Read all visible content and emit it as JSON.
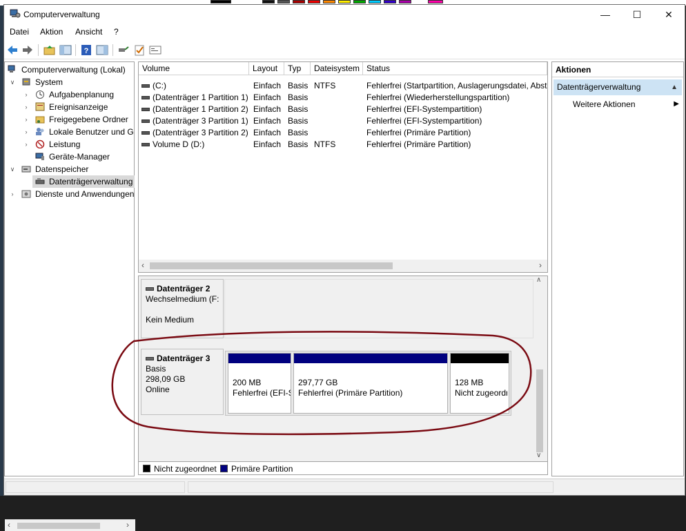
{
  "window": {
    "title": "Computerverwaltung"
  },
  "menu": {
    "items": [
      "Datei",
      "Aktion",
      "Ansicht",
      "?"
    ]
  },
  "tree": {
    "items": [
      {
        "label": "Computerverwaltung (Lokal)"
      },
      {
        "label": "System"
      },
      {
        "label": "Aufgabenplanung"
      },
      {
        "label": "Ereignisanzeige"
      },
      {
        "label": "Freigegebene Ordner"
      },
      {
        "label": "Lokale Benutzer und Gruppen"
      },
      {
        "label": "Leistung"
      },
      {
        "label": "Geräte-Manager"
      },
      {
        "label": "Datenspeicher"
      },
      {
        "label": "Datenträgerverwaltung"
      },
      {
        "label": "Dienste und Anwendungen"
      }
    ]
  },
  "volumes": {
    "columns": [
      "Volume",
      "Layout",
      "Typ",
      "Dateisystem",
      "Status"
    ],
    "rows": [
      {
        "volume": "(C:)",
        "layout": "Einfach",
        "typ": "Basis",
        "fs": "NTFS",
        "status": "Fehlerfrei (Startpartition, Auslagerungsdatei, Absturzabbild, Primäre Partition)"
      },
      {
        "volume": "(Datenträger 1 Partition 1)",
        "layout": "Einfach",
        "typ": "Basis",
        "fs": "",
        "status": "Fehlerfrei (Wiederherstellungspartition)"
      },
      {
        "volume": "(Datenträger 1 Partition 2)",
        "layout": "Einfach",
        "typ": "Basis",
        "fs": "",
        "status": "Fehlerfrei (EFI-Systempartition)"
      },
      {
        "volume": "(Datenträger 3 Partition 1)",
        "layout": "Einfach",
        "typ": "Basis",
        "fs": "",
        "status": "Fehlerfrei (EFI-Systempartition)"
      },
      {
        "volume": "(Datenträger 3 Partition 2)",
        "layout": "Einfach",
        "typ": "Basis",
        "fs": "",
        "status": "Fehlerfrei (Primäre Partition)"
      },
      {
        "volume": "Volume D (D:)",
        "layout": "Einfach",
        "typ": "Basis",
        "fs": "NTFS",
        "status": "Fehlerfrei (Primäre Partition)"
      }
    ]
  },
  "disks": {
    "disk2": {
      "name": "Datenträger 2",
      "type": "Wechselmedium (F:)",
      "status": "Kein Medium"
    },
    "disk3": {
      "name": "Datenträger 3",
      "type": "Basis",
      "size": "298,09 GB",
      "status": "Online",
      "partitions": [
        {
          "size": "200 MB",
          "status": "Fehlerfrei (EFI-Systempartition)",
          "color": "#00007f"
        },
        {
          "size": "297,77 GB",
          "status": "Fehlerfrei (Primäre Partition)",
          "color": "#00007f"
        },
        {
          "size": "128 MB",
          "status": "Nicht zugeordnet",
          "color": "#000000"
        }
      ]
    }
  },
  "legend": [
    {
      "label": "Nicht zugeordnet",
      "color": "#000000"
    },
    {
      "label": "Primäre Partition",
      "color": "#00007f"
    }
  ],
  "actions": {
    "title": "Aktionen",
    "section": "Datenträgerverwaltung",
    "more": "Weitere Aktionen"
  },
  "annotation_color": "#7a0a12"
}
